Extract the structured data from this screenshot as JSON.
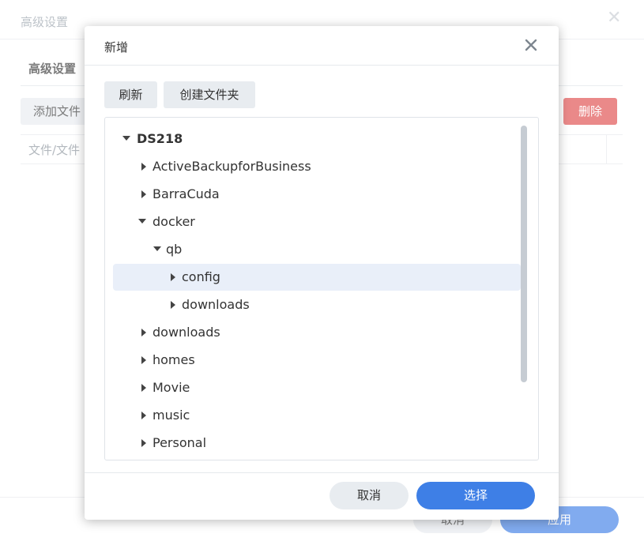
{
  "background": {
    "title": "高级设置",
    "tab": "高级设置",
    "add_button": "添加文件",
    "delete_button": "删除",
    "column_header": "文件/文件",
    "cancel_button": "取消",
    "apply_button": "应用",
    "colors": {
      "primary": "#3e7fe6",
      "danger": "#df4b4b"
    }
  },
  "dialog": {
    "title": "新增",
    "refresh_button": "刷新",
    "new_folder_button": "创建文件夹",
    "cancel_button": "取消",
    "select_button": "选择",
    "tree": {
      "root": "DS218",
      "items": [
        {
          "label": "ActiveBackupforBusiness",
          "expanded": false
        },
        {
          "label": "BarraCuda",
          "expanded": false
        },
        {
          "label": "docker",
          "expanded": true
        },
        {
          "label": "qb",
          "expanded": true
        },
        {
          "label": "config",
          "expanded": false,
          "selected": true
        },
        {
          "label": "downloads",
          "expanded": false
        },
        {
          "label": "downloads",
          "expanded": false
        },
        {
          "label": "homes",
          "expanded": false
        },
        {
          "label": "Movie",
          "expanded": false
        },
        {
          "label": "music",
          "expanded": false
        },
        {
          "label": "Personal",
          "expanded": false
        }
      ]
    }
  }
}
